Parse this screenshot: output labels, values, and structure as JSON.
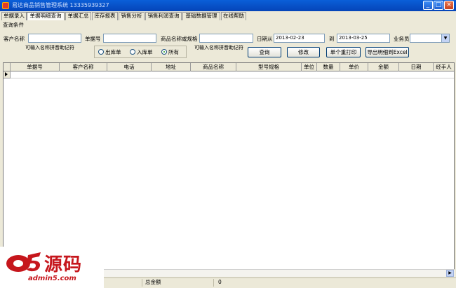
{
  "window": {
    "title": "易达商品销售管理系统 13335939327",
    "min": "_",
    "max": "□",
    "close": "×"
  },
  "tabs": [
    "单据录入",
    "单据明细查询",
    "单据汇总",
    "库存报表",
    "销售分析",
    "销售利润查询",
    "基础数据管理",
    "在线帮助"
  ],
  "active_tab": "单据明细查询",
  "query": {
    "group_caption": "查询条件",
    "customer_label": "客户名称",
    "customer_value": "",
    "customer_hint": "可输入名称拼音助记符",
    "doc_no_label": "单据号",
    "doc_no_value": "",
    "product_label": "商品名称或规格",
    "product_value": "",
    "product_hint": "可输入名称拼音助记符",
    "date_from_label": "日期从",
    "date_from_value": "2013-02-23",
    "date_to_label": "到",
    "date_to_value": "2013-03-25",
    "salesman_label": "业务员",
    "salesman_value": "",
    "radio_out": "出库单",
    "radio_in": "入库单",
    "radio_all": "所有",
    "radio_selected": "所有",
    "btn_query": "查询",
    "btn_edit": "修改",
    "btn_reprint": "单个重打印",
    "btn_export": "导出明细到Excel"
  },
  "table": {
    "columns": [
      "单据号",
      "客户名称",
      "电话",
      "地址",
      "商品名称",
      "型号规格",
      "单位",
      "数量",
      "单价",
      "金额",
      "日期",
      "经手人"
    ],
    "rows": []
  },
  "status": {
    "total_label": "总金额",
    "total_value": "0"
  },
  "watermark": {
    "logo_text": "源码",
    "logo_url": "admin5.com",
    "logo_color": "#c6161c"
  }
}
